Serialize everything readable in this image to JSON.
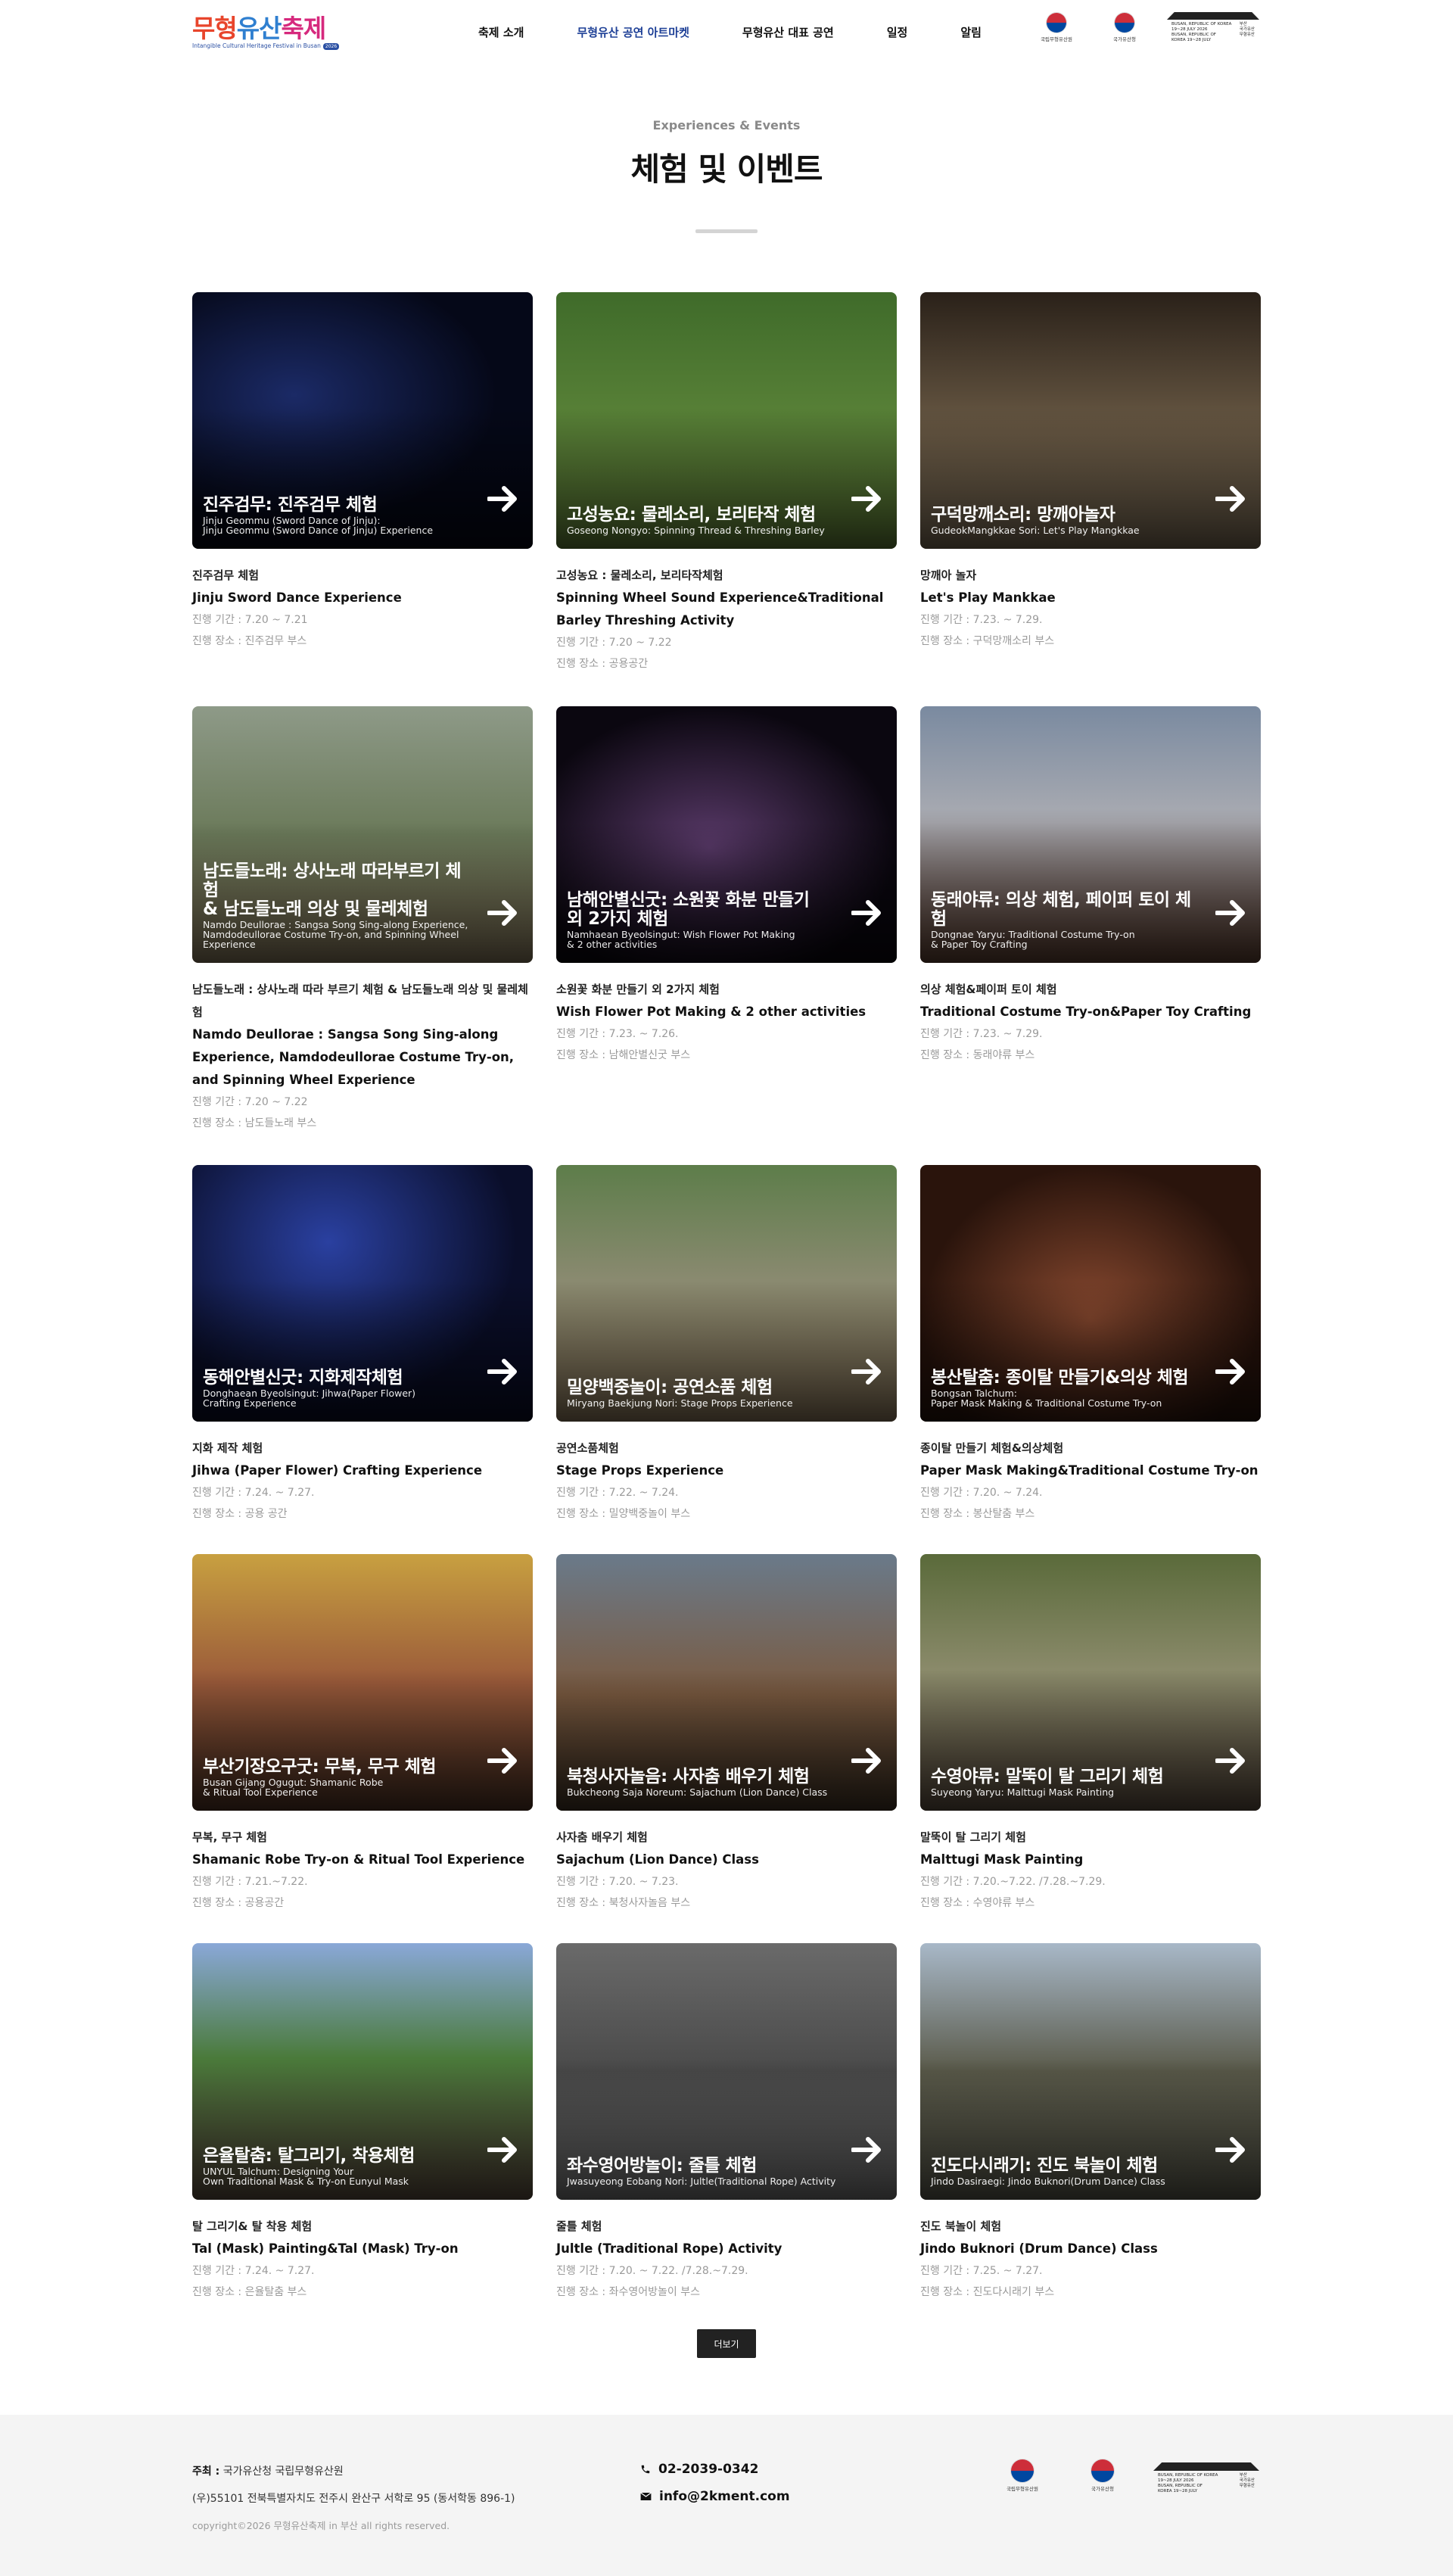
{
  "header": {
    "logo": {
      "word1": "무형",
      "word2": "유산",
      "word3": "축제",
      "sub": "Intangible Cultural Heritage Festival in Busan",
      "badge": "2026"
    },
    "nav": [
      {
        "label": "축제 소개"
      },
      {
        "label": "무형유산 공연 아트마켓"
      },
      {
        "label": "무형유산 대표 공연"
      },
      {
        "label": "일정"
      },
      {
        "label": "알림"
      }
    ],
    "org1": "국립무형유산원",
    "org2": "국가유산청",
    "stamp": {
      "left": "BUSAN, REPUBLIC OF KOREA\n19~28 JULY 2026\nBUSAN, REPUBLIC OF\nKOREA 19~28 JULY",
      "right": "부산\n국가유산\n무형유산"
    }
  },
  "section": {
    "eyebrow": "Experiences & Events",
    "title": "체험 및 이벤트"
  },
  "cards": [
    {
      "ov_title": "진주검무: 진주검무 체험",
      "ov_sub": "Jinju Geommu (Sword Dance of Jinju):\nJinju Geommu (Sword Dance of Jinju) Experience",
      "ko": "진주검무 체험",
      "en": "Jinju Sword Dance Experience",
      "period": "진행 기간 : 7.20 ~ 7.21",
      "place": "진행 장소 : 진주검무 부스"
    },
    {
      "ov_title": "고성농요: 물레소리, 보리타작 체험",
      "ov_sub": "Goseong Nongyo: Spinning Thread & Threshing Barley",
      "ko": "고성농요 : 물레소리, 보리타작체험",
      "en": "Spinning Wheel Sound Experience&Traditional Barley Threshing Activity",
      "period": "진행 기간 : 7.20 ~ 7.22",
      "place": "진행 장소 : 공용공간"
    },
    {
      "ov_title": "구덕망깨소리: 망깨아놀자",
      "ov_sub": "GudeokMangkkae Sori: Let's Play Mangkkae",
      "ko": "망깨아 놀자",
      "en": "Let's Play Mankkae",
      "period": "진행 기간 : 7.23. ~ 7.29.",
      "place": "진행 장소 : 구덕망깨소리 부스"
    },
    {
      "ov_title": "남도들노래: 상사노래 따라부르기 체험\n& 남도들노래 의상 및 물레체험",
      "ov_sub": "Namdo Deullorae : Sangsa Song Sing-along Experience,\nNamdodeullorae Costume Try-on, and Spinning Wheel Experience",
      "ko": "남도들노래 : 상사노래 따라 부르기 체험 & 남도들노래 의상 및 물레체험",
      "en": "Namdo Deullorae : Sangsa Song Sing-along Experience, Namdodeullorae Costume Try-on, and Spinning Wheel Experience",
      "period": "진행 기간 : 7.20 ~ 7.22",
      "place": "진행 장소 : 남도들노래 부스"
    },
    {
      "ov_title": "남해안별신굿: 소원꽃 화분 만들기\n외 2가지 체험",
      "ov_sub": "Namhaean Byeolsingut: Wish Flower Pot Making\n& 2 other activities",
      "ko": "소원꽃 화분 만들기 외 2가지 체험",
      "en": "Wish Flower Pot Making & 2 other activities",
      "period": "진행 기간 : 7.23. ~ 7.26.",
      "place": "진행 장소 : 남해안별신굿 부스"
    },
    {
      "ov_title": "동래야류: 의상 체험, 페이퍼 토이 체험",
      "ov_sub": "Dongnae Yaryu: Traditional Costume Try-on\n& Paper Toy Crafting",
      "ko": "의상 체험&페이퍼 토이 체험",
      "en": "Traditional Costume Try-on&Paper Toy Crafting",
      "period": "진행 기간 : 7.23. ~ 7.29.",
      "place": "진행 장소 : 동래야류 부스"
    },
    {
      "ov_title": "동해안별신굿: 지화제작체험",
      "ov_sub": "Donghaean Byeolsingut: Jihwa(Paper Flower)\nCrafting Experience",
      "ko": "지화 제작 체험",
      "en": "Jihwa (Paper Flower) Crafting Experience",
      "period": "진행 기간 : 7.24. ~ 7.27.",
      "place": "진행 장소 : 공용 공간"
    },
    {
      "ov_title": "밀양백중놀이: 공연소품 체험",
      "ov_sub": "Miryang Baekjung Nori: Stage Props Experience",
      "ko": "공연소품체험",
      "en": "Stage Props Experience",
      "period": "진행 기간 : 7.22. ~ 7.24.",
      "place": "진행 장소 : 밀양백중놀이 부스"
    },
    {
      "ov_title": "봉산탈춤: 종이탈 만들기&의상 체험",
      "ov_sub": "Bongsan Talchum:\nPaper Mask Making & Traditional Costume Try-on",
      "ko": "종이탈 만들기 체험&의상체험",
      "en": "Paper Mask Making&Traditional Costume Try-on",
      "period": "진행 기간 : 7.20. ~ 7.24.",
      "place": "진행 장소 : 봉산탈춤 부스"
    },
    {
      "ov_title": "부산기장오구굿: 무복, 무구 체험",
      "ov_sub": "Busan Gijang Ogugut: Shamanic Robe\n& Ritual Tool Experience",
      "ko": "무복, 무구 체험",
      "en": "Shamanic Robe Try-on & Ritual Tool Experience",
      "period": "진행 기간 : 7.21.~7.22.",
      "place": "진행 장소 : 공용공간"
    },
    {
      "ov_title": "북청사자놀음: 사자춤 배우기 체험",
      "ov_sub": "Bukcheong Saja Noreum: Sajachum (Lion Dance) Class",
      "ko": "사자춤 배우기 체험",
      "en": "Sajachum (Lion Dance) Class",
      "period": "진행 기간 : 7.20. ~ 7.23.",
      "place": "진행 장소 : 북청사자놀음 부스"
    },
    {
      "ov_title": "수영야류: 말뚝이 탈 그리기 체험",
      "ov_sub": "Suyeong Yaryu: Malttugi Mask Painting",
      "ko": "말뚝이 탈 그리기 체험",
      "en": "Malttugi Mask Painting",
      "period": "진행 기간 : 7.20.~7.22. /7.28.~7.29.",
      "place": "진행 장소 : 수영야류 부스"
    },
    {
      "ov_title": "은율탈춤: 탈그리기, 착용체험",
      "ov_sub": "UNYUL Talchum: Designing Your\nOwn Traditional Mask & Try-on Eunyul Mask",
      "ko": "탈 그리기& 탈 착용 체험",
      "en": "Tal (Mask) Painting&Tal (Mask) Try-on",
      "period": "진행 기간 : 7.24. ~ 7.27.",
      "place": "진행 장소 : 은율탈춤 부스"
    },
    {
      "ov_title": "좌수영어방놀이: 줄틀 체험",
      "ov_sub": "Jwasuyeong Eobang Nori: Jultle(Traditional Rope) Activity",
      "ko": "줄틀 체험",
      "en": "Jultle (Traditional Rope) Activity",
      "period": "진행 기간 : 7.20. ~ 7.22. /7.28.~7.29.",
      "place": "진행 장소 : 좌수영어방놀이 부스"
    },
    {
      "ov_title": "진도다시래기: 진도 북놀이 체험",
      "ov_sub": "Jindo Dasiraegi: Jindo Buknori(Drum Dance) Class",
      "ko": "진도 북놀이 체험",
      "en": "Jindo Buknori (Drum Dance) Class",
      "period": "진행 기간 : 7.25. ~ 7.27.",
      "place": "진행 장소 : 진도다시래기 부스"
    }
  ],
  "more_label": "더보기",
  "footer": {
    "host_label": "주최 :",
    "host": "국가유산청 국립무형유산원",
    "address": "(우)55101 전북특별자치도 전주시 완산구 서학로 95 (동서학동 896-1)",
    "copyright": "copyright©2026 무형유산축제 in 부산 all rights reserved.",
    "phone": "02-2039-0342",
    "email": "info@2kment.com",
    "org1": "국립무형유산원",
    "org2": "국가유산청"
  },
  "colors": {
    "accent_nav": "#1d3f96",
    "button_dark": "#222222",
    "footer_bg": "#f4f4f4"
  }
}
